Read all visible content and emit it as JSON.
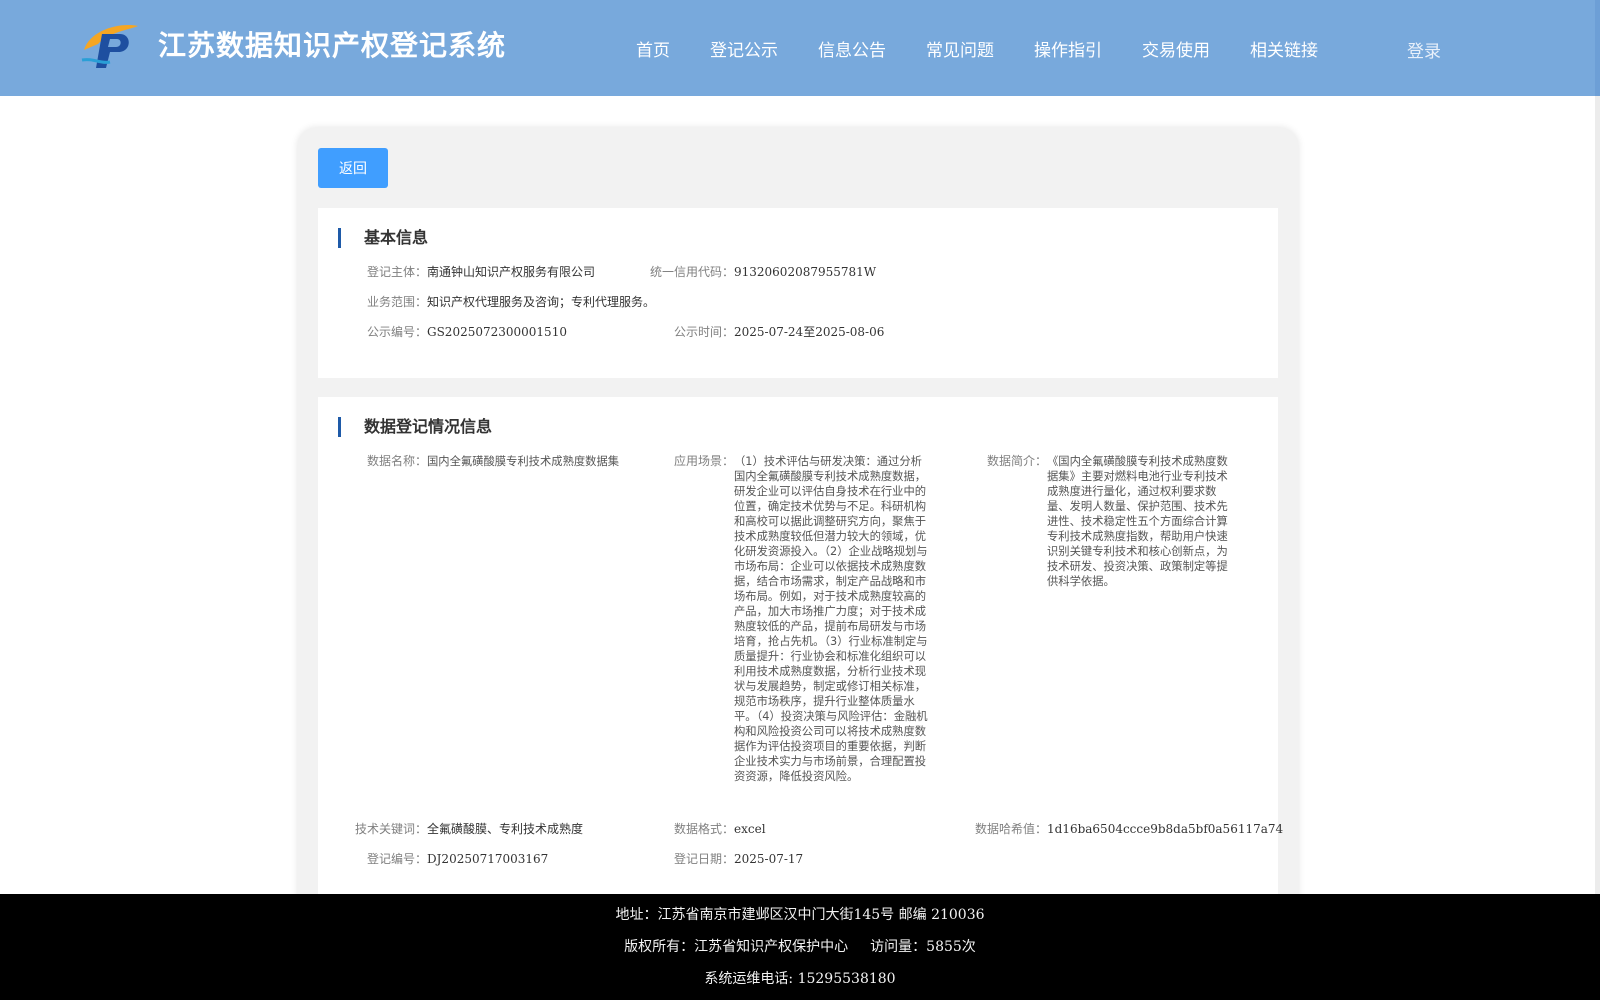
{
  "header": {
    "site_title": "江苏数据知识产权登记系统",
    "nav": [
      "首页",
      "登记公示",
      "信息公告",
      "常见问题",
      "操作指引",
      "交易使用",
      "相关链接"
    ],
    "login": "登录",
    "bg_color": "#78a9dc"
  },
  "back_button": "返回",
  "basic_info": {
    "title": "基本信息",
    "entity_label": "登记主体：",
    "entity": "南通钟山知识产权服务有限公司",
    "credit_code_label": "统一信用代码：",
    "credit_code": "91320602087955781W",
    "scope_label": "业务范围：",
    "scope": "知识产权代理服务及咨询；专利代理服务。",
    "notice_no_label": "公示编号：",
    "notice_no": "GS2025072300001510",
    "notice_time_label": "公示时间：",
    "notice_time": "2025-07-24至2025-08-06"
  },
  "registration_info": {
    "title": "数据登记情况信息",
    "data_name_label": "数据名称：",
    "data_name": "国内全氟磺酸膜专利技术成熟度数据集",
    "scenario_label": "应用场景：",
    "scenario": "（1）技术评估与研发决策：通过分析国内全氟磺酸膜专利技术成熟度数据，研发企业可以评估自身技术在行业中的位置，确定技术优势与不足。科研机构和高校可以据此调整研究方向，聚焦于技术成熟度较低但潜力较大的领域，优化研发资源投入。（2）企业战略规划与市场布局：企业可以依据技术成熟度数据，结合市场需求，制定产品战略和市场布局。例如，对于技术成熟度较高的产品，加大市场推广力度；对于技术成熟度较低的产品，提前布局研发与市场培育，抢占先机。（3）行业标准制定与质量提升：行业协会和标准化组织可以利用技术成熟度数据，分析行业技术现状与发展趋势，制定或修订相关标准，规范市场秩序，提升行业整体质量水平。（4）投资决策与风险评估：金融机构和风险投资公司可以将技术成熟度数据作为评估投资项目的重要依据，判断企业技术实力与市场前景，合理配置投资资源，降低投资风险。",
    "summary_label": "数据简介：",
    "summary": "《国内全氟磺酸膜专利技术成熟度数据集》主要对燃料电池行业专利技术成熟度进行量化，通过权利要求数量、发明人数量、保护范围、技术先进性、技术稳定性五个方面综合计算专利技术成熟度指数，帮助用户快速识别关键专利技术和核心创新点，为技术研发、投资决策、政策制定等提供科学依据。",
    "keywords_label": "技术关键词：",
    "keywords": "全氟磺酸膜、专利技术成熟度",
    "format_label": "数据格式：",
    "format": "excel",
    "hash_label": "数据哈希值：",
    "hash": "1d16ba6504ccce9b8da5bf0a56117a74",
    "reg_no_label": "登记编号：",
    "reg_no": "DJ20250717003167",
    "reg_date_label": "登记日期：",
    "reg_date": "2025-07-17"
  },
  "footer": {
    "address": "地址：江苏省南京市建邺区汉中门大街145号 邮编 210036",
    "copyright": "版权所有：江苏省知识产权保护中心",
    "visits": "访问量：5855次",
    "phone": "系统运维电话: 15295538180"
  }
}
